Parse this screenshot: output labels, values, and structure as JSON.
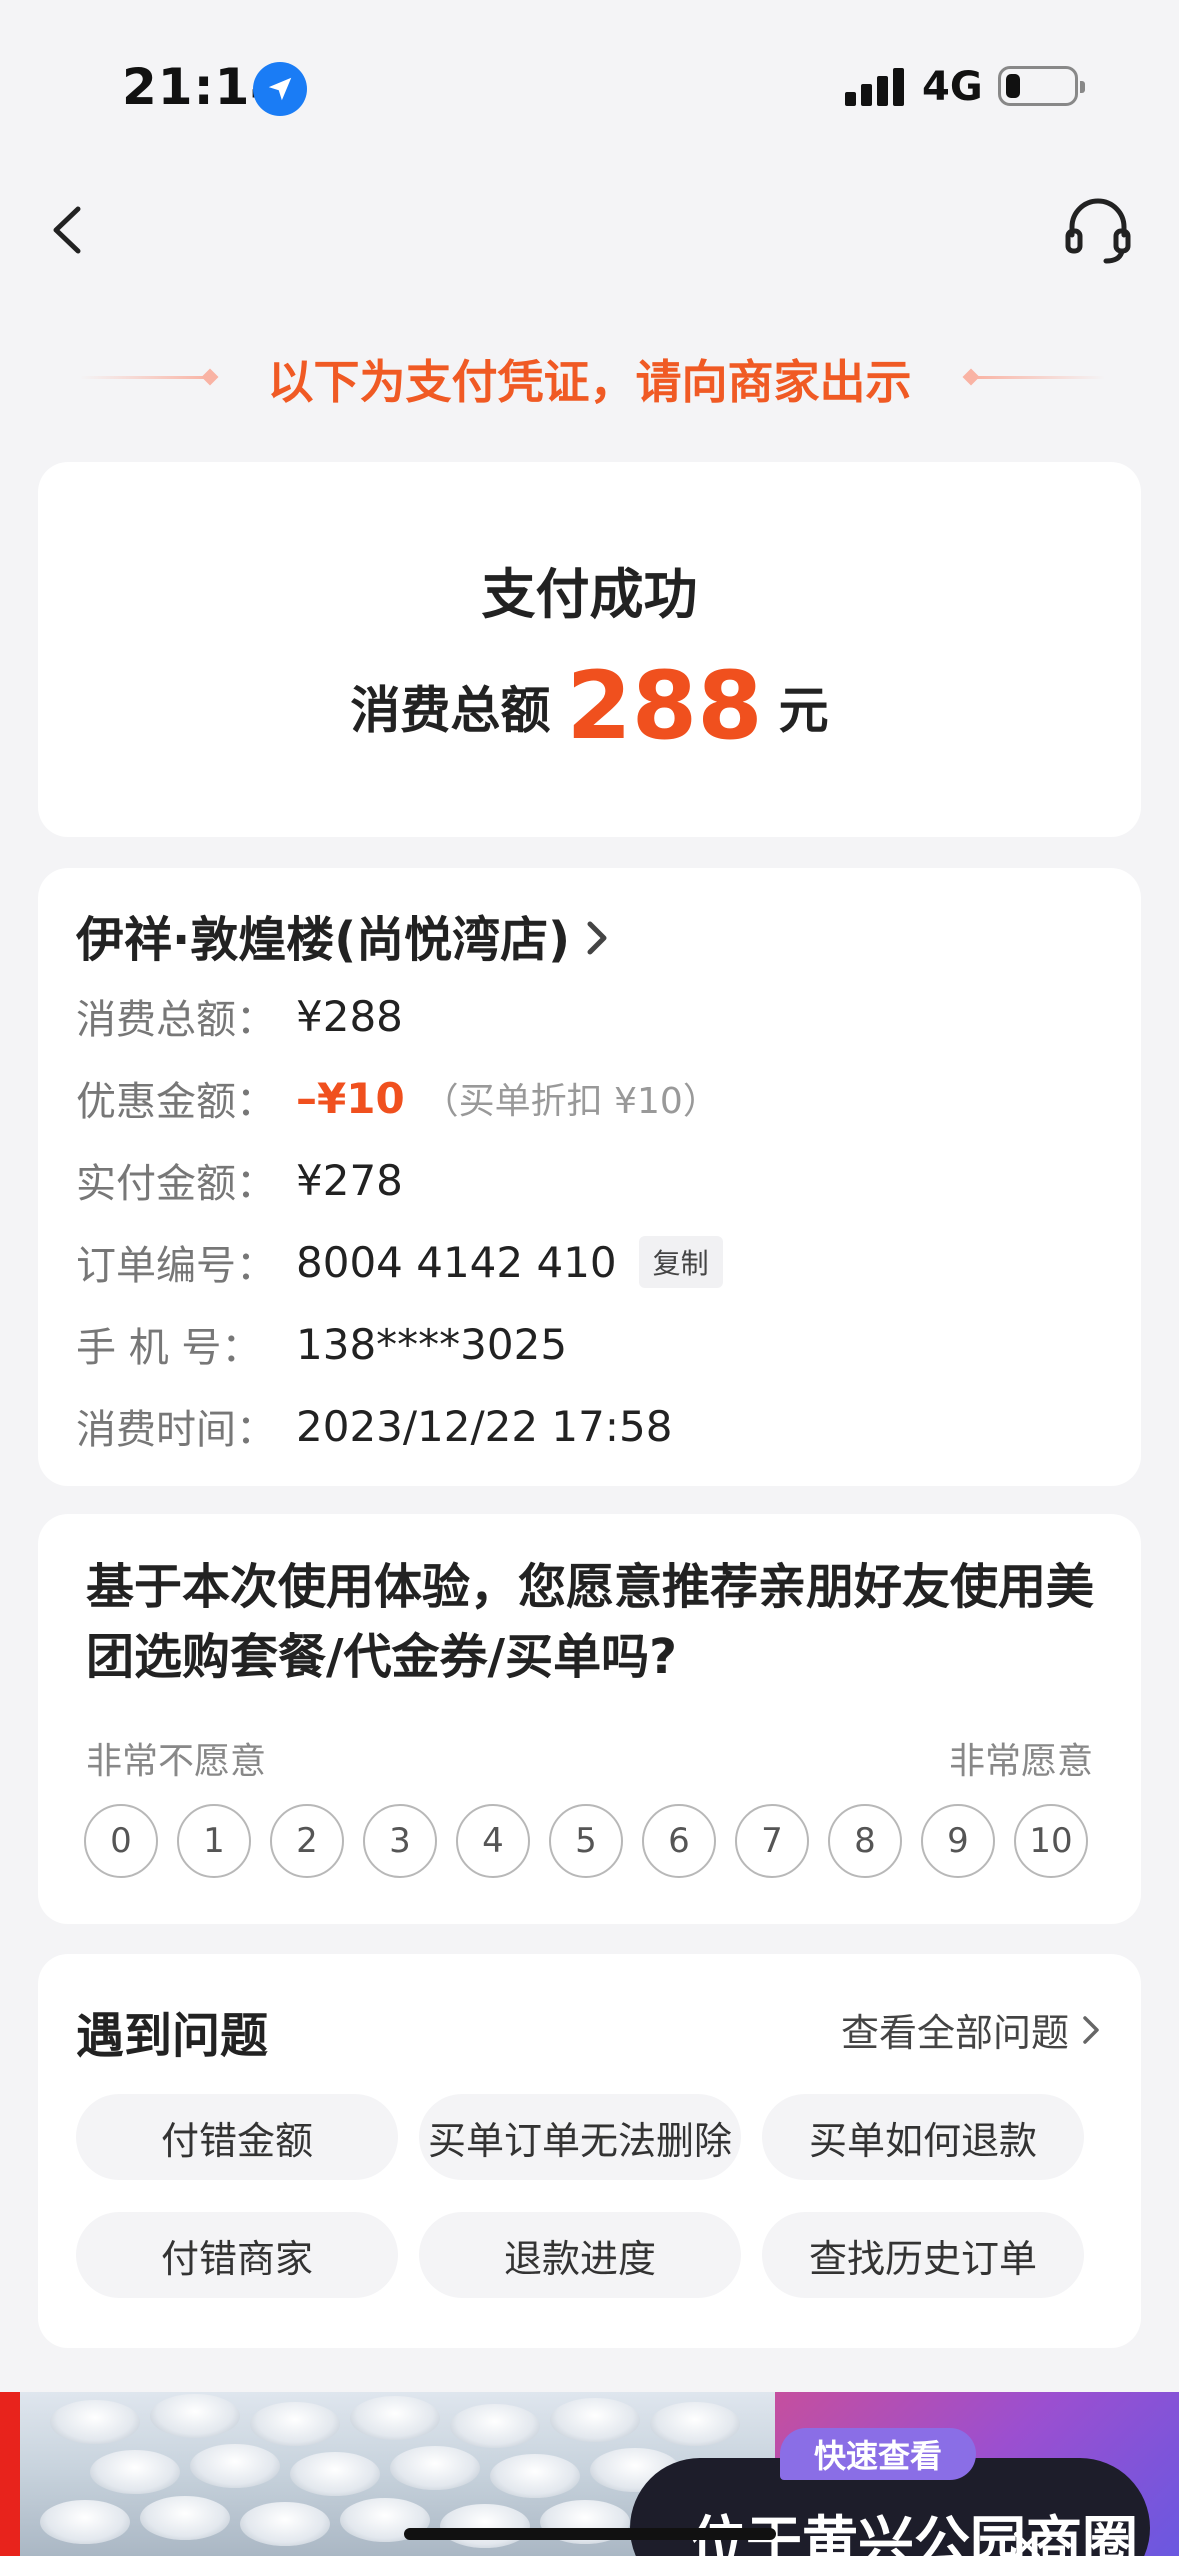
{
  "status_bar": {
    "time": "21:14",
    "network": "4G"
  },
  "header": {
    "notice": "以下为支付凭证，请向商家出示"
  },
  "payment": {
    "title": "支付成功",
    "total_label": "消费总额",
    "total_amount": "288",
    "total_unit": "元"
  },
  "order": {
    "shop_name": "伊祥·敦煌楼(尚悦湾店)",
    "rows": {
      "total": {
        "label": "消费总额：",
        "value": "¥288"
      },
      "discount": {
        "label": "优惠金额：",
        "value": "–¥10",
        "note": "（买单折扣 ¥10）"
      },
      "paid": {
        "label": "实付金额：",
        "value": "¥278"
      },
      "order_no": {
        "label": "订单编号：",
        "value": "8004 4142 410",
        "copy_label": "复制"
      },
      "phone": {
        "label": "手 机 号：",
        "value": "138****3025"
      },
      "time": {
        "label": "消费时间：",
        "value": "2023/12/22 17:58"
      }
    }
  },
  "survey": {
    "question": "基于本次使用体验，您愿意推荐亲朋好友使用美团选购套餐/代金券/买单吗?",
    "low_label": "非常不愿意",
    "high_label": "非常愿意",
    "scores": [
      "0",
      "1",
      "2",
      "3",
      "4",
      "5",
      "6",
      "7",
      "8",
      "9",
      "10"
    ]
  },
  "faq": {
    "title": "遇到问题",
    "view_all": "查看全部问题",
    "items": [
      "付错金额",
      "买单订单无法删除",
      "买单如何退款",
      "付错商家",
      "退款进度",
      "查找历史订单"
    ]
  },
  "banner": {
    "tag": "快速查看",
    "headline": "位于黄兴公园商圈"
  },
  "colors": {
    "accent": "#f0501e",
    "location": "#1a7cf5"
  },
  "icons": [
    "location-arrow-icon",
    "signal-icon",
    "battery-icon",
    "back-chevron-icon",
    "headset-icon",
    "chevron-right-icon",
    "close-icon"
  ]
}
